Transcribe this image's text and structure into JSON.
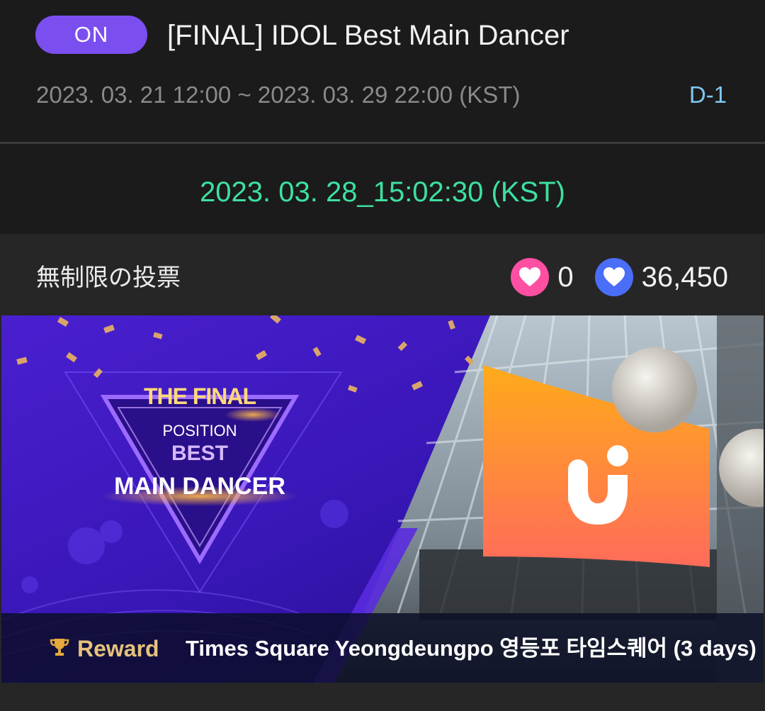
{
  "event": {
    "status": "ON",
    "title": "[FINAL] IDOL Best Main Dancer",
    "period": "2023. 03. 21 12:00 ~ 2023. 03. 29 22:00 (KST)",
    "dday": "D-1"
  },
  "timer": {
    "value": "2023. 03. 28_15:02:30 (KST)"
  },
  "vote": {
    "label": "無制限の投票",
    "pink_count": "0",
    "blue_count": "36,450"
  },
  "banner": {
    "headline_top": "THE FINAL",
    "headline_mid": "POSITION",
    "headline_best": "BEST",
    "headline_bottom": "MAIN DANCER",
    "reward_label": "Reward",
    "reward_text": "Times Square Yeongdeungpo 영등포 타임스퀘어 (3 days)"
  },
  "colors": {
    "accent_purple": "#7b4ef0",
    "timer_green": "#3ee0a0",
    "dday_blue": "#7ec8f2",
    "heart_pink": "#ff4fa3",
    "heart_blue": "#4a6ef7",
    "reward_gold": "#e6c27a"
  },
  "icons": [
    "heart-icon",
    "trophy-icon"
  ]
}
